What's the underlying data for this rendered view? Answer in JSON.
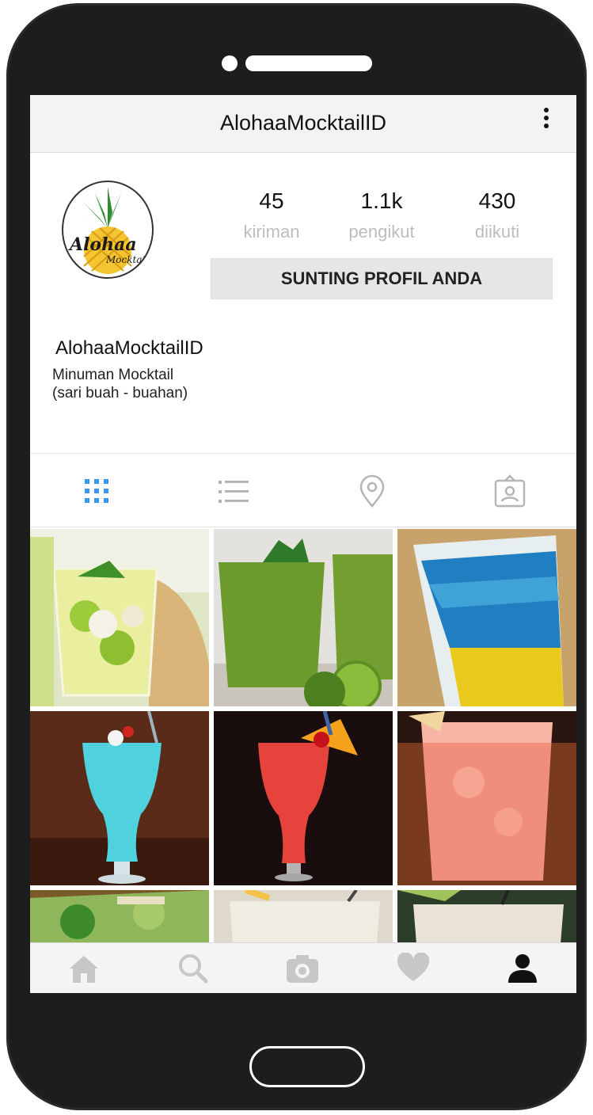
{
  "app": {
    "title": "AlohaaMocktailID"
  },
  "profile": {
    "avatar_text": "Alohaa Mocktail",
    "username": "AlohaaMocktailID",
    "bio_line1": "Minuman Mocktail",
    "bio_line2": "(sari buah - buahan)",
    "stats": [
      {
        "value": "45",
        "label": "kiriman"
      },
      {
        "value": "1.1k",
        "label": "pengikut"
      },
      {
        "value": "430",
        "label": "diikuti"
      }
    ],
    "edit_button": "SUNTING PROFIL ANDA"
  },
  "tabs": [
    {
      "icon": "grid-icon",
      "active": true
    },
    {
      "icon": "list-icon",
      "active": false
    },
    {
      "icon": "location-pin-icon",
      "active": false
    },
    {
      "icon": "tagged-person-icon",
      "active": false
    }
  ],
  "posts": [
    {
      "subject": "kiwi lychee mocktail"
    },
    {
      "subject": "kiwi smoothie"
    },
    {
      "subject": "blue layered mocktail"
    },
    {
      "subject": "blue hurricane mocktail"
    },
    {
      "subject": "red hurricane mocktail with orange"
    },
    {
      "subject": "pink lemonade"
    },
    {
      "subject": "mint mojito"
    },
    {
      "subject": "lemon drink"
    },
    {
      "subject": "lemonade"
    }
  ],
  "bottom_nav": [
    "home-icon",
    "search-icon",
    "camera-icon",
    "heart-icon",
    "profile-icon"
  ],
  "colors": {
    "accent": "#3897f0",
    "nav_active": "#111111",
    "nav_inactive": "#c7c7c7",
    "label_gray": "#bdbdbd"
  }
}
